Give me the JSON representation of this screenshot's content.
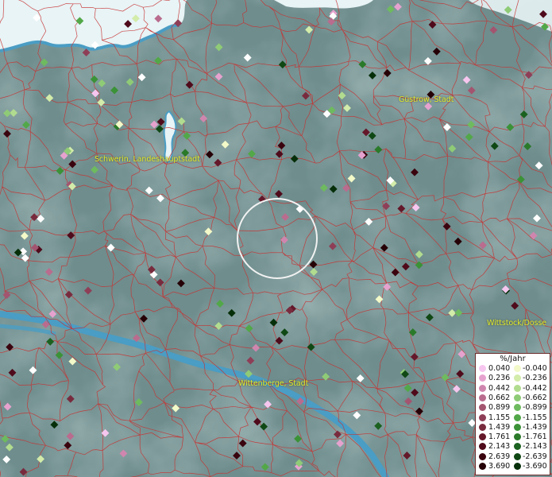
{
  "cities": [
    {
      "id": "guestrow",
      "name": "Güstrow, Stadt"
    },
    {
      "id": "schwerin",
      "name": "Schwerin, Landeshauptstadt"
    },
    {
      "id": "wittstock",
      "name": "Wittstock/Dosse"
    },
    {
      "id": "wittenberge",
      "name": "Wittenberge, Stadt"
    }
  ],
  "legend": {
    "title": "%/Jahr",
    "positive": [
      "0.040",
      "0.236",
      "0.442",
      "0.662",
      "0.899",
      "1.155",
      "1.439",
      "1.761",
      "2.143",
      "2.639",
      "3.690"
    ],
    "negative": [
      "-0.040",
      "-0.236",
      "-0.442",
      "-0.662",
      "-0.899",
      "-1.155",
      "-1.439",
      "-1.761",
      "-2.143",
      "-2.639",
      "-3.690"
    ],
    "positive_colors": [
      "#f6c6ef",
      "#e6a2cf",
      "#cf86ae",
      "#b96c8e",
      "#a35570",
      "#8e3f57",
      "#792b3e",
      "#64182a",
      "#4f0b1b",
      "#3a040f",
      "#250006"
    ],
    "negative_colors": [
      "#f3f9c8",
      "#d3ecaa",
      "#b1dc8f",
      "#8fcb76",
      "#6ebb5f",
      "#52a848",
      "#3b9237",
      "#2a7a2a",
      "#1b611f",
      "#0f4814",
      "#062f09"
    ]
  },
  "colors": {
    "boundary": "#c83232",
    "water": "#4a9dc4",
    "sea": "#e8f4f6",
    "land": "#6f8d8d",
    "city_label": "#e3ea2a"
  }
}
